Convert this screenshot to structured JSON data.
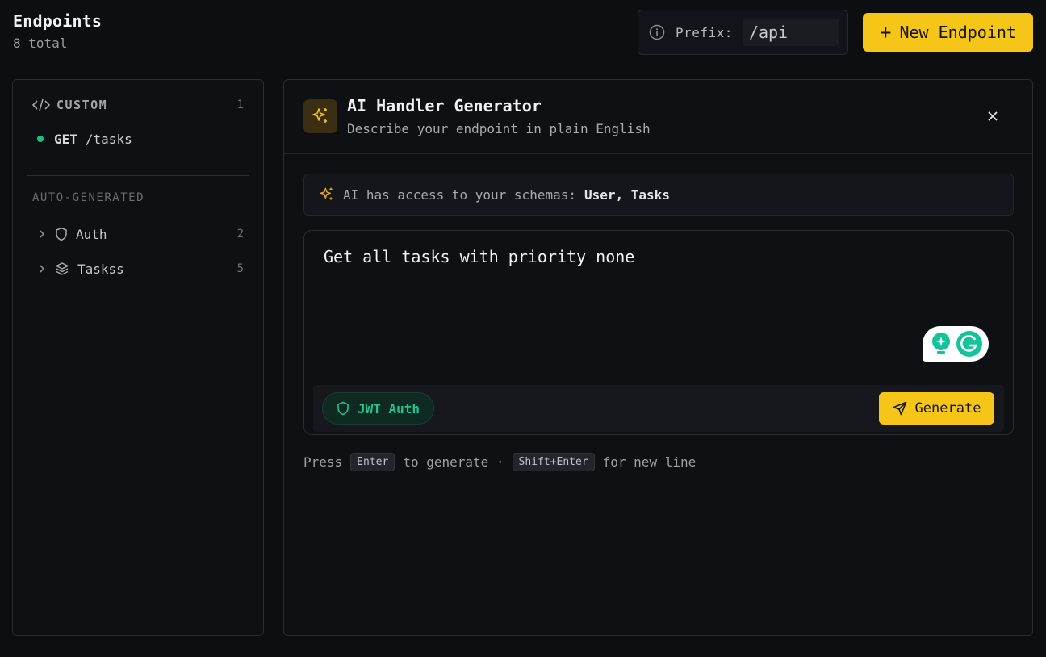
{
  "header": {
    "title": "Endpoints",
    "subtitle": "8 total"
  },
  "prefix": {
    "label": "Prefix:",
    "value": "/api"
  },
  "new_endpoint_button": {
    "plus": "+",
    "label": "New Endpoint"
  },
  "sidebar": {
    "custom": {
      "label": "CUSTOM",
      "count": "1"
    },
    "custom_endpoints": [
      {
        "method": "GET",
        "path": "/tasks",
        "status_color": "#1fbf7a"
      }
    ],
    "auto_generated_label": "AUTO-GENERATED",
    "groups": [
      {
        "label": "Auth",
        "count": "2",
        "icon": "shield-icon"
      },
      {
        "label": "Taskss",
        "count": "5",
        "icon": "layers-icon"
      }
    ]
  },
  "panel": {
    "title": "AI Handler Generator",
    "subtitle": "Describe your endpoint in plain English",
    "schema_notice": {
      "text": "AI has access to your schemas:",
      "schemas": "User, Tasks"
    },
    "prompt": {
      "value": "Get all tasks with priority none"
    },
    "auth_chip": "JWT Auth",
    "generate_label": "Generate",
    "hint": {
      "press": "Press",
      "key1": "Enter",
      "mid": "to generate ·",
      "key2": "Shift+Enter",
      "end": "for new line"
    }
  },
  "colors": {
    "accent": "#f5c518",
    "success": "#1fbf7a",
    "background": "#0d0e12"
  }
}
